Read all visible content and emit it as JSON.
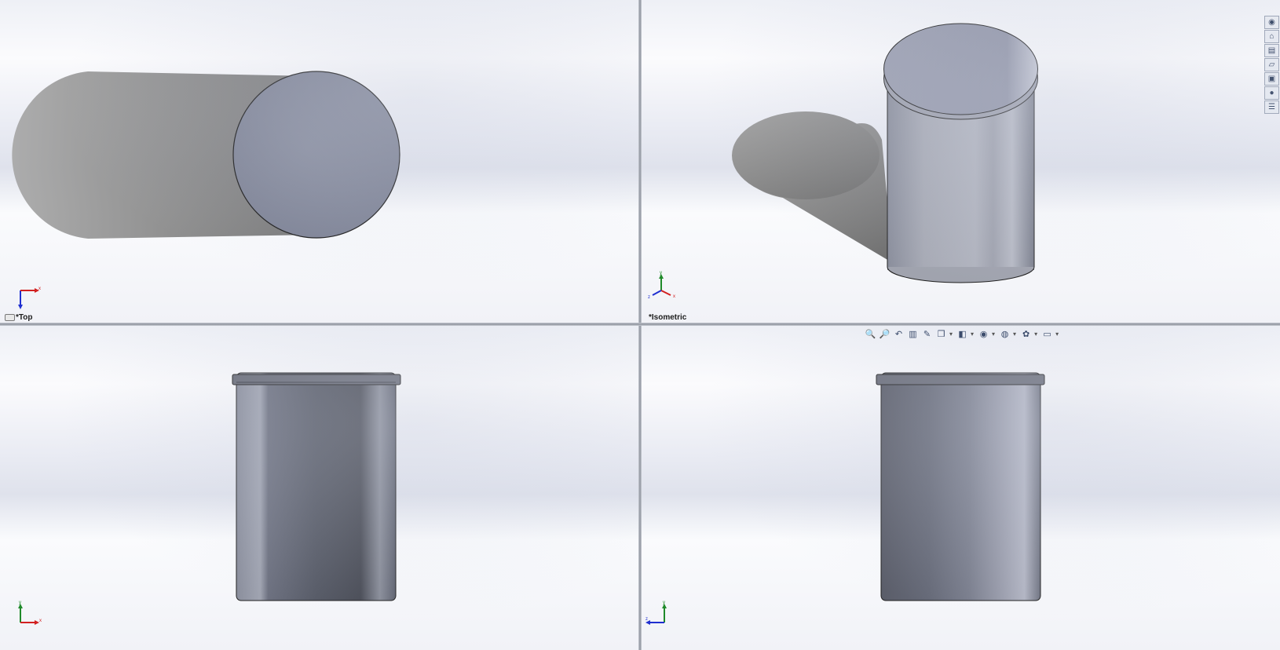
{
  "viewports": {
    "top": {
      "label": "*Top"
    },
    "isometric": {
      "label": "*Isometric"
    },
    "front": {
      "label": ""
    },
    "right": {
      "label": ""
    }
  },
  "triad": {
    "x": "x",
    "y": "y",
    "z": "z"
  },
  "heads_up_toolbar": [
    {
      "icon": "zoom-to-fit-icon",
      "glyph": "🔍"
    },
    {
      "icon": "zoom-to-area-icon",
      "glyph": "🔎"
    },
    {
      "icon": "previous-view-icon",
      "glyph": "↶"
    },
    {
      "icon": "section-view-icon",
      "glyph": "▥"
    },
    {
      "icon": "dynamic-annotation-icon",
      "glyph": "✎"
    },
    {
      "icon": "view-orientation-icon",
      "glyph": "❒"
    },
    {
      "icon": "display-style-icon",
      "glyph": "◧"
    },
    {
      "icon": "hide-show-items-icon",
      "glyph": "◉"
    },
    {
      "icon": "edit-appearance-icon",
      "glyph": "◍"
    },
    {
      "icon": "apply-scene-icon",
      "glyph": "✿"
    },
    {
      "icon": "view-settings-icon",
      "glyph": "▭"
    }
  ],
  "task_pane": [
    {
      "icon": "solidworks-resources-icon",
      "glyph": "◉"
    },
    {
      "icon": "home-icon",
      "glyph": "⌂"
    },
    {
      "icon": "design-library-icon",
      "glyph": "▤"
    },
    {
      "icon": "file-explorer-icon",
      "glyph": "▱"
    },
    {
      "icon": "view-palette-icon",
      "glyph": "▣"
    },
    {
      "icon": "appearances-icon",
      "glyph": "●"
    },
    {
      "icon": "custom-properties-icon",
      "glyph": "☰"
    }
  ],
  "colors": {
    "body_face": "#7f8597",
    "body_dark": "#4a4d57",
    "shadow": "#8a8a8a",
    "axis_x": "#d22020",
    "axis_y": "#1f8a2a",
    "axis_z": "#1f2fd0"
  }
}
